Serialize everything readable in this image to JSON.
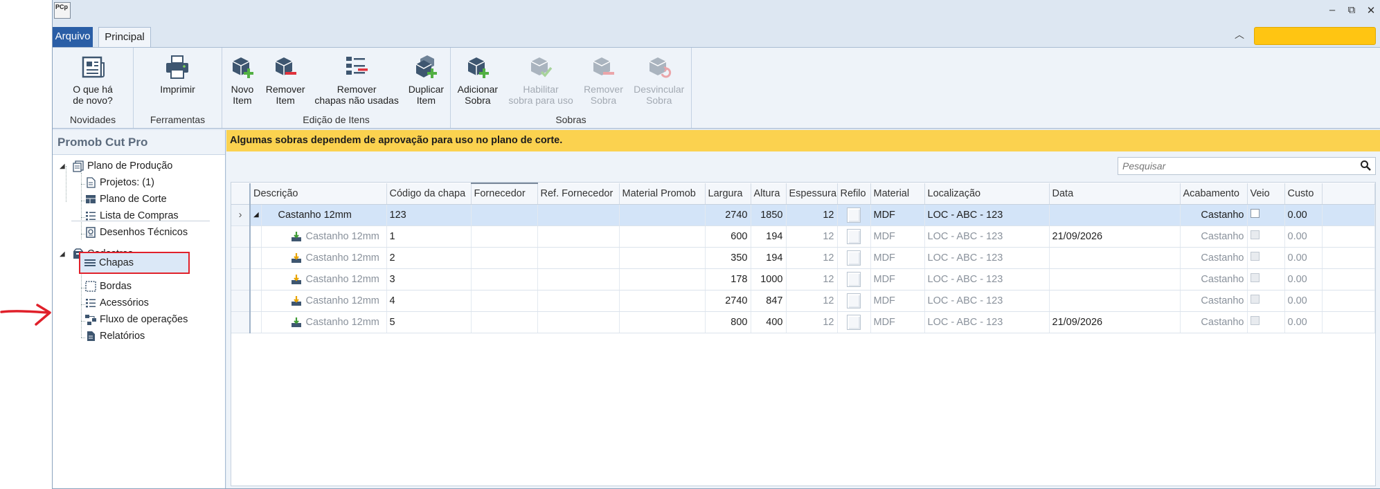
{
  "app": {
    "logo_text": "PCp"
  },
  "window_controls": [
    "–",
    "⧉",
    "✕"
  ],
  "tabs": {
    "file": "Arquivo",
    "main": "Principal"
  },
  "ribbon": {
    "groups": [
      {
        "label": "Novidades",
        "buttons": [
          {
            "label": "O que há\nde novo?",
            "icon": "newspaper-icon",
            "enabled": true
          }
        ]
      },
      {
        "label": "Ferramentas",
        "buttons": [
          {
            "label": "Imprimir",
            "icon": "printer-icon",
            "enabled": true
          }
        ]
      },
      {
        "label": "Edição de Itens",
        "buttons": [
          {
            "label": "Novo\nItem",
            "icon": "box-add-icon",
            "enabled": true
          },
          {
            "label": "Remover\nItem",
            "icon": "box-remove-icon",
            "enabled": true
          },
          {
            "label": "Remover\nchapas não usadas",
            "icon": "list-remove-icon",
            "enabled": true
          },
          {
            "label": "Duplicar\nItem",
            "icon": "box-duplicate-icon",
            "enabled": true
          }
        ]
      },
      {
        "label": "Sobras",
        "buttons": [
          {
            "label": "Adicionar\nSobra",
            "icon": "box-add-icon",
            "enabled": true
          },
          {
            "label": "Habilitar\nsobra para uso",
            "icon": "box-check-icon",
            "enabled": false
          },
          {
            "label": "Remover\nSobra",
            "icon": "box-remove-icon",
            "enabled": false
          },
          {
            "label": "Desvincular\nSobra",
            "icon": "box-unlink-icon",
            "enabled": false
          }
        ]
      }
    ]
  },
  "sidebar": {
    "title": "Promob Cut Pro",
    "production": {
      "label": "Plano de Produção",
      "items": [
        "Projetos: (1)",
        "Plano de Corte",
        "Lista de Compras",
        "Desenhos Técnicos"
      ]
    },
    "cadastros": {
      "label": "Cadastros",
      "items": [
        "Chapas",
        "Bordas",
        "Acessórios",
        "Fluxo de operações",
        "Relatórios"
      ]
    }
  },
  "banner": "Algumas sobras dependem de aprovação para uso no plano de corte.",
  "search": {
    "placeholder": "Pesquisar"
  },
  "grid": {
    "columns": [
      "Descrição",
      "Código da chapa",
      "Fornecedor",
      "Ref. Fornecedor",
      "Material Promob",
      "Largura",
      "Altura",
      "Espessura",
      "Refilo",
      "Material",
      "Localização",
      "Data",
      "Acabamento",
      "Veio",
      "Custo"
    ],
    "parent": {
      "descricao": "Castanho 12mm",
      "codigo": "123",
      "largura": "2740",
      "altura": "1850",
      "espessura": "12",
      "material": "MDF",
      "localizacao": "LOC - ABC - 123",
      "data": "",
      "acabamento": "Castanho",
      "custo": "0.00"
    },
    "rows": [
      {
        "descricao": "Castanho 12mm",
        "codigo": "1",
        "largura": "600",
        "altura": "194",
        "espessura": "12",
        "material": "MDF",
        "localizacao": "LOC - ABC - 123",
        "data": "21/09/2026",
        "acabamento": "Castanho",
        "custo": "0.00",
        "status": "approved"
      },
      {
        "descricao": "Castanho 12mm",
        "codigo": "2",
        "largura": "350",
        "altura": "194",
        "espessura": "12",
        "material": "MDF",
        "localizacao": "LOC - ABC - 123",
        "data": "",
        "acabamento": "Castanho",
        "custo": "0.00",
        "status": "pending"
      },
      {
        "descricao": "Castanho 12mm",
        "codigo": "3",
        "largura": "178",
        "altura": "1000",
        "espessura": "12",
        "material": "MDF",
        "localizacao": "LOC - ABC - 123",
        "data": "",
        "acabamento": "Castanho",
        "custo": "0.00",
        "status": "pending"
      },
      {
        "descricao": "Castanho 12mm",
        "codigo": "4",
        "largura": "2740",
        "altura": "847",
        "espessura": "12",
        "material": "MDF",
        "localizacao": "LOC - ABC - 123",
        "data": "",
        "acabamento": "Castanho",
        "custo": "0.00",
        "status": "pending"
      },
      {
        "descricao": "Castanho 12mm",
        "codigo": "5",
        "largura": "800",
        "altura": "400",
        "espessura": "12",
        "material": "MDF",
        "localizacao": "LOC - ABC - 123",
        "data": "21/09/2026",
        "acabamento": "Castanho",
        "custo": "0.00",
        "status": "approved"
      }
    ]
  },
  "colors": {
    "accent": "#2a5ea6",
    "banner": "#fbd24f",
    "selection": "#d3e4f8",
    "annotation": "#e0202a",
    "user_badge": "#ffc512"
  }
}
